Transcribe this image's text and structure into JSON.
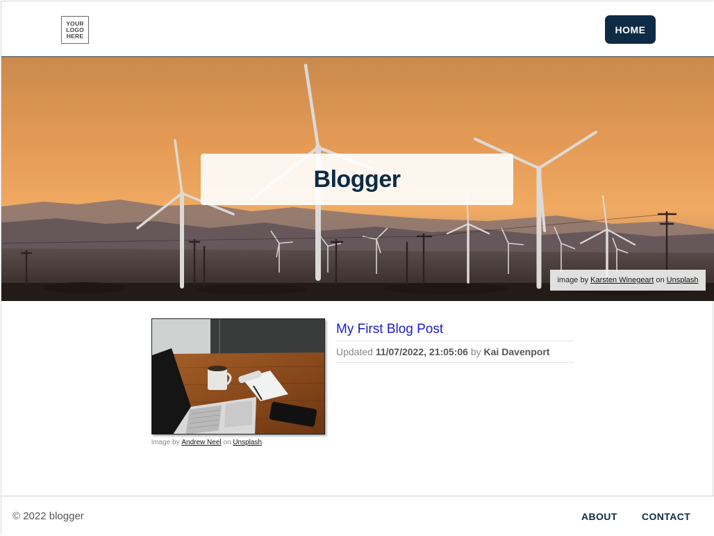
{
  "header": {
    "logo_lines": [
      "YOUR",
      "LOGO",
      "HERE"
    ],
    "home_label": "HOME"
  },
  "hero": {
    "title": "Blogger",
    "image_alt_icon": "wind-turbines-sunset-image",
    "credit": {
      "prefix": "image by",
      "author": "Karsten Winegeart",
      "middle": "on",
      "source": "Unsplash"
    }
  },
  "post": {
    "title": "My First Blog Post",
    "thumbnail_icon": "laptop-desk-image",
    "meta": {
      "updated_label": "Updated",
      "date": "11/07/2022, 21:05:06",
      "by_label": "by",
      "author": "Kai Davenport"
    },
    "credit": {
      "prefix": "image by",
      "author": "Andrew Neel",
      "middle": "on",
      "source": "Unsplash"
    }
  },
  "footer": {
    "copyright": "© 2022 blogger",
    "links": [
      "ABOUT",
      "CONTACT"
    ]
  },
  "colors": {
    "brand_navy": "#0d2b45",
    "post_link": "#1a1acc"
  }
}
